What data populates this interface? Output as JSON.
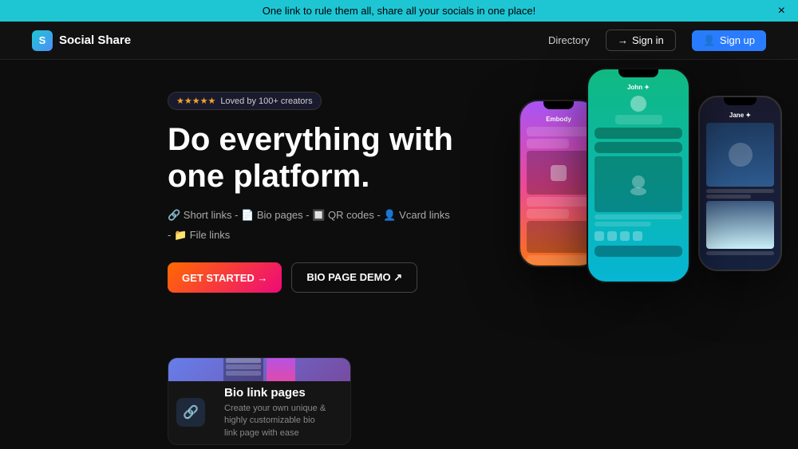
{
  "banner": {
    "text": "One link to rule them all, share all your socials in one place!",
    "close_label": "×"
  },
  "navbar": {
    "logo_letter": "S",
    "logo_name": "Social Share",
    "directory_label": "Directory",
    "signin_label": "Sign in",
    "signup_label": "Sign up"
  },
  "hero": {
    "badge_stars": "★★★★★",
    "badge_text": "Loved by 100+ creators",
    "title_line1": "Do everything with",
    "title_line2": "one platform.",
    "features": "🔗 Short links -  📄 Bio pages -  🔲 QR codes -  👤 Vcard links -  📁 File links",
    "cta_primary": "GET STARTED →",
    "cta_secondary": "BIO PAGE DEMO ↗"
  },
  "phones": {
    "left": {
      "label": "Embody"
    },
    "center": {
      "name": "John ✦"
    },
    "right": {
      "name": "Jane ✦"
    }
  },
  "bottom": {
    "card_title": "Bio link pages",
    "card_desc": "Create your own unique & highly customizable bio link page with ease"
  }
}
